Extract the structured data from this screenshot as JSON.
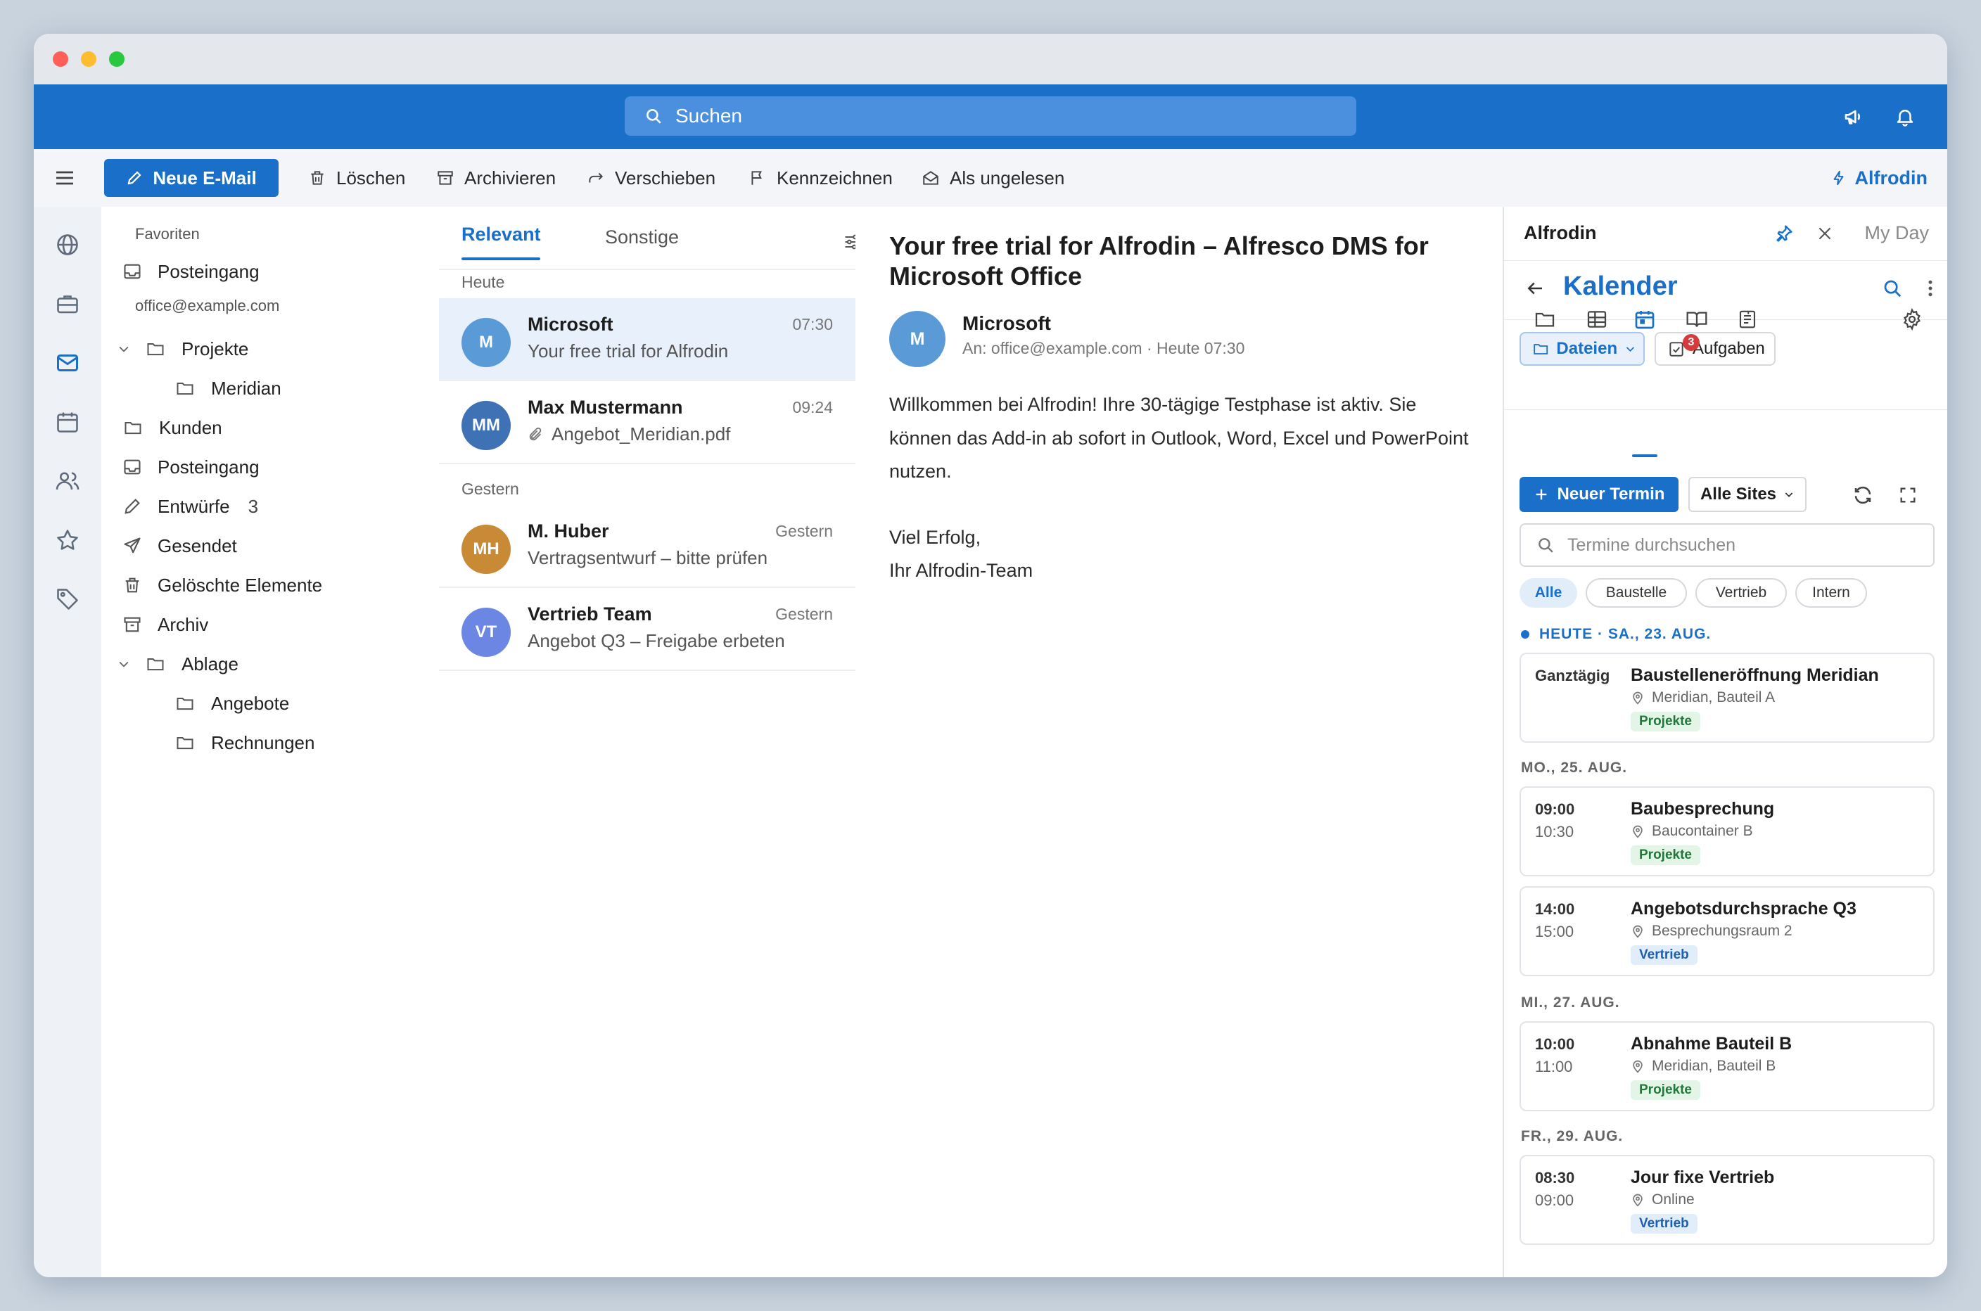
{
  "search": {
    "placeholder": "Suchen"
  },
  "toolbar": {
    "new_mail": "Neue E-Mail",
    "delete": "Löschen",
    "archive": "Archivieren",
    "move": "Verschieben",
    "flag": "Kennzeichnen",
    "unread": "Als ungelesen",
    "addin": "Alfrodin"
  },
  "folders": {
    "favorites_label": "Favoriten",
    "fav_inbox": "Posteingang",
    "account": "office@example.com",
    "items": {
      "projekte": "Projekte",
      "meridian": "Meridian",
      "kunden": "Kunden",
      "posteingang": "Posteingang",
      "entwuerfe": "Entwürfe",
      "entwuerfe_count": "3",
      "gesendet": "Gesendet",
      "geloescht": "Gelöschte Elemente",
      "archiv": "Archiv",
      "ablage": "Ablage",
      "angebote": "Angebote",
      "rechnungen": "Rechnungen"
    }
  },
  "mail_list": {
    "tab_relevant": "Relevant",
    "tab_other": "Sonstige",
    "group_today": "Heute",
    "group_yesterday": "Gestern",
    "items": [
      {
        "initials": "M",
        "from": "Microsoft",
        "subject": "Your free trial for Alfrodin",
        "time": "07:30",
        "color": "#5a9ad6"
      },
      {
        "initials": "MM",
        "from": "Max Mustermann",
        "subject": "Angebot_Meridian.pdf",
        "time": "09:24",
        "color": "#3f72b5"
      },
      {
        "initials": "MH",
        "from": "M. Huber",
        "subject": "Vertragsentwurf – bitte prüfen",
        "time": "Gestern",
        "color": "#c98a36"
      },
      {
        "initials": "VT",
        "from": "Vertrieb Team",
        "subject": "Angebot Q3 – Freigabe erbeten",
        "time": "Gestern",
        "color": "#6b86e3"
      }
    ]
  },
  "reader": {
    "title": "Your free trial for Alfrodin – Alfresco DMS for Microsoft Office",
    "avatar": "M",
    "from": "Microsoft",
    "meta": "An: office@example.com · Heute 07:30",
    "body_p1": "Willkommen bei Alfrodin! Ihre 30-tägige Testphase ist aktiv. Sie können das Add-in ab sofort in Outlook, Word, Excel und PowerPoint nutzen.",
    "body_l1": "Viel Erfolg,",
    "body_l2": "Ihr Alfrodin-Team"
  },
  "pane": {
    "name": "Alfrodin",
    "my_day": "My Day",
    "title": "Kalender",
    "btn_files": "Dateien",
    "btn_tasks": "Aufgaben",
    "tasks_badge": "3",
    "new_event": "Neuer Termin",
    "sites": "Alle Sites",
    "search_placeholder": "Termine durchsuchen",
    "chips": [
      "Alle",
      "Baustelle",
      "Vertrieb",
      "Intern"
    ],
    "days": {
      "d1": "HEUTE · SA., 23. AUG.",
      "d2": "MO., 25. AUG.",
      "d3": "MI., 27. AUG.",
      "d4": "FR., 29. AUG."
    },
    "events": [
      {
        "t1": "Ganztägig",
        "t2": "",
        "title": "Baustelleneröffnung Meridian",
        "loc": "Meridian, Bauteil A",
        "tag": "Projekte"
      },
      {
        "t1": "09:00",
        "t2": "10:30",
        "title": "Baubesprechung",
        "loc": "Baucontainer B",
        "tag": "Projekte"
      },
      {
        "t1": "14:00",
        "t2": "15:00",
        "title": "Angebotsdurchsprache Q3",
        "loc": "Besprechungsraum 2",
        "tag": "Vertrieb"
      },
      {
        "t1": "10:00",
        "t2": "11:00",
        "title": "Abnahme Bauteil B",
        "loc": "Meridian, Bauteil B",
        "tag": "Projekte"
      },
      {
        "t1": "08:30",
        "t2": "09:00",
        "title": "Jour fixe Vertrieb",
        "loc": "Online",
        "tag": "Vertrieb"
      }
    ]
  },
  "colors": {
    "accent": "#1a6fc9",
    "tag_green": "#1f7a3a",
    "badge_red": "#d63a3a"
  }
}
